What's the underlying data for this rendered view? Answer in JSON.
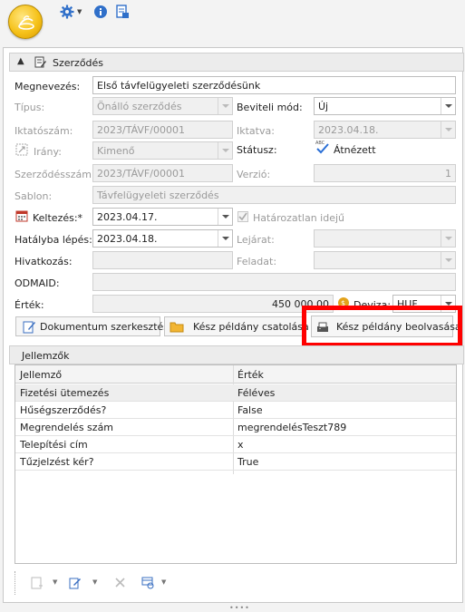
{
  "toolbar": {
    "icons": [
      "app-logo",
      "gear-icon",
      "info-icon",
      "export-icon"
    ]
  },
  "contract": {
    "section_title": "Szerződés",
    "fields": {
      "name_label": "Megnevezés:",
      "name_value": "Első távfelügyeleti szerződésünk",
      "type_label": "Típus:",
      "type_value": "Önálló szerződés",
      "input_mode_label": "Beviteli mód:",
      "input_mode_value": "Új",
      "filing_no_label": "Iktatószám:",
      "filing_no_value": "2023/TÁVF/00001",
      "filed_label": "Iktatva:",
      "filed_value": "2023.04.18.",
      "direction_label": "Irány:",
      "direction_value": "Kimenő",
      "status_label": "Státusz:",
      "status_value": "Átnézett",
      "contract_no_label": "Szerződésszám:",
      "contract_no_value": "2023/TÁVF/00001",
      "version_label": "Verzió:",
      "version_value": "1",
      "template_label": "Sablon:",
      "template_value": "Távfelügyeleti szerződés",
      "date_label": "Keltezés:*",
      "date_value": "2023.04.17.",
      "indefinite_label": "Határozatlan idejű",
      "effective_label": "Hatályba lépés:*",
      "effective_value": "2023.04.18.",
      "expiry_label": "Lejárat:",
      "expiry_value": "",
      "reference_label": "Hivatkozás:",
      "reference_value": "",
      "sender_label": "Feladat:",
      "sender_value": "",
      "odmaid_label": "ODMAID:",
      "odmaid_value": "",
      "value_label": "Érték:",
      "value_value": "450 000,00",
      "currency_label": "Deviza:",
      "currency_value": "HUF"
    },
    "buttons": {
      "edit_document": "Dokumentum szerkesztése",
      "attach_final": "Kész példány csatolása",
      "scan_final": "Kész példány beolvasása"
    }
  },
  "attributes": {
    "section_title": "Jellemzők",
    "columns": [
      "Jellemző",
      "Érték"
    ],
    "rows": [
      {
        "name": "Fizetési ütemezés",
        "value": "Féléves"
      },
      {
        "name": "Hűségszerződés?",
        "value": "False"
      },
      {
        "name": "Megrendelés szám",
        "value": "megrendelésTeszt789"
      },
      {
        "name": "Telepítési cím",
        "value": "x"
      },
      {
        "name": "Tűzjelzést kér?",
        "value": "True"
      }
    ]
  },
  "colors": {
    "highlight": "#ff0000",
    "status_check": "#2a6fd6"
  }
}
